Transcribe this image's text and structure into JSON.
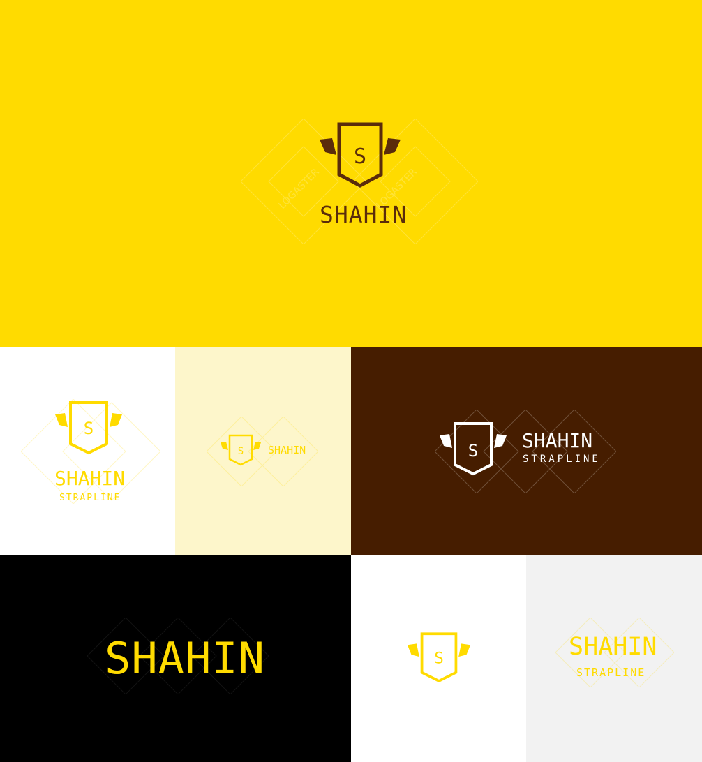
{
  "brand": {
    "name": "SHAHIN",
    "strapline": "STRAPLINE",
    "monogram": "S",
    "watermark": "LOGASTER"
  },
  "colors": {
    "yellow": "#FFDB00",
    "pale_yellow": "#FDF6CB",
    "brown": "#461D00",
    "dark_brown": "#5A2C0B",
    "black": "#000000",
    "white": "#FFFFFF",
    "light_gray": "#F2F2F2"
  },
  "icons": [
    "shield-crest-icon",
    "ribbon-banner-icon",
    "logaster-watermark-icon"
  ]
}
